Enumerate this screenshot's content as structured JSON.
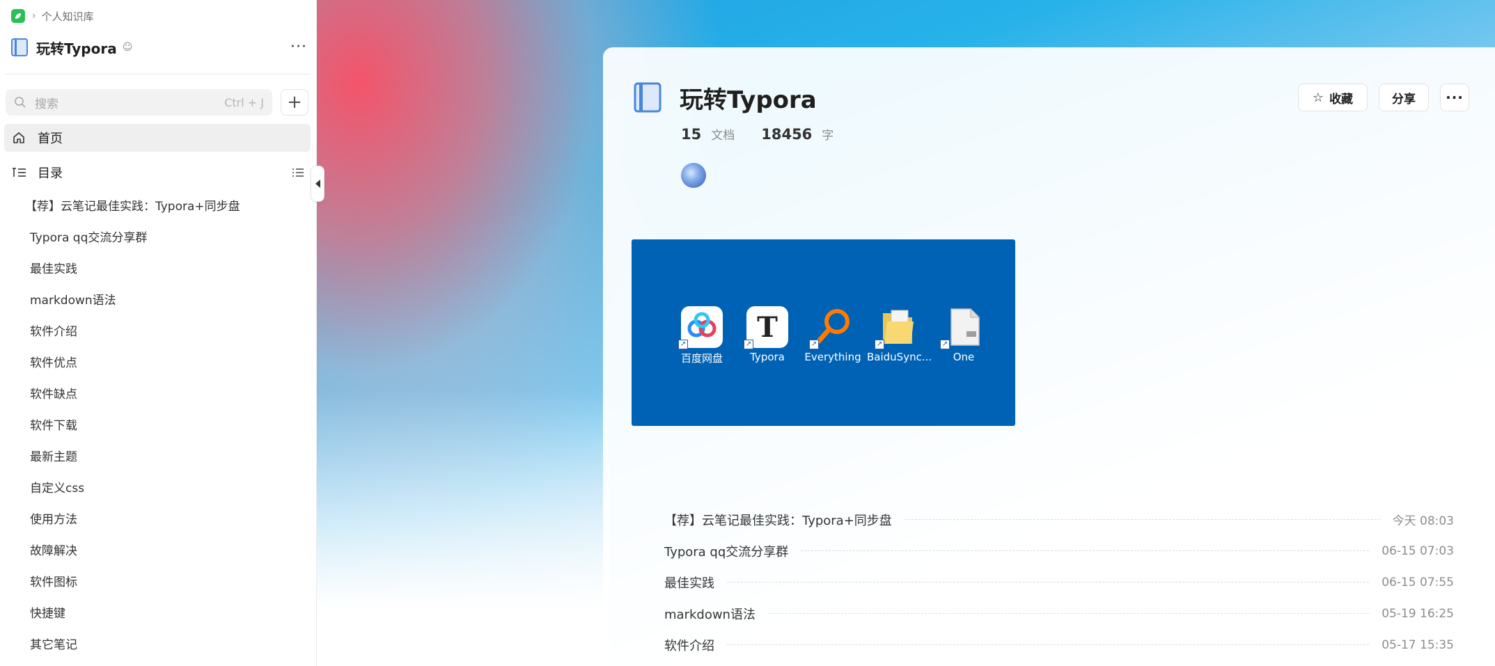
{
  "breadcrumb": {
    "parent": "个人知识库"
  },
  "sidebar": {
    "kb_title": "玩转Typora",
    "more_label": "···",
    "search": {
      "placeholder": "搜索",
      "shortcut": "Ctrl + J"
    },
    "add_label": "+",
    "nav": {
      "home": "首页",
      "toc": "目录"
    },
    "toc_items": [
      "【荐】云笔记最佳实践：Typora+同步盘",
      "Typora qq交流分享群",
      "最佳实践",
      "markdown语法",
      "软件介绍",
      "软件优点",
      "软件缺点",
      "软件下载",
      "最新主题",
      "自定义css",
      "使用方法",
      "故障解决",
      "软件图标",
      "快捷键",
      "其它笔记"
    ]
  },
  "main": {
    "title": "玩转Typora",
    "stats": {
      "docs_count": "15",
      "docs_unit": "文档",
      "words_count": "18456",
      "words_unit": "字"
    },
    "buttons": {
      "favorite": "收藏",
      "share": "分享",
      "more": "···"
    },
    "desktop_icons": [
      {
        "label": "百度网盘",
        "icon": "baidu-netdisk-icon"
      },
      {
        "label": "Typora",
        "icon": "typora-icon"
      },
      {
        "label": "Everything",
        "icon": "everything-search-icon"
      },
      {
        "label": "BaiduSync...",
        "icon": "folder-icon"
      },
      {
        "label": "One",
        "icon": "file-icon"
      }
    ],
    "docs": [
      {
        "title": "【荐】云笔记最佳实践：Typora+同步盘",
        "date": "今天 08:03"
      },
      {
        "title": "Typora qq交流分享群",
        "date": "06-15 07:03"
      },
      {
        "title": "最佳实践",
        "date": "06-15 07:55"
      },
      {
        "title": "markdown语法",
        "date": "05-19 16:25"
      },
      {
        "title": "软件介绍",
        "date": "05-17 15:35"
      }
    ]
  },
  "colors": {
    "accent": "#2dbf57",
    "desktop_bg": "#0062b5",
    "book_blue": "#4a86d8"
  }
}
